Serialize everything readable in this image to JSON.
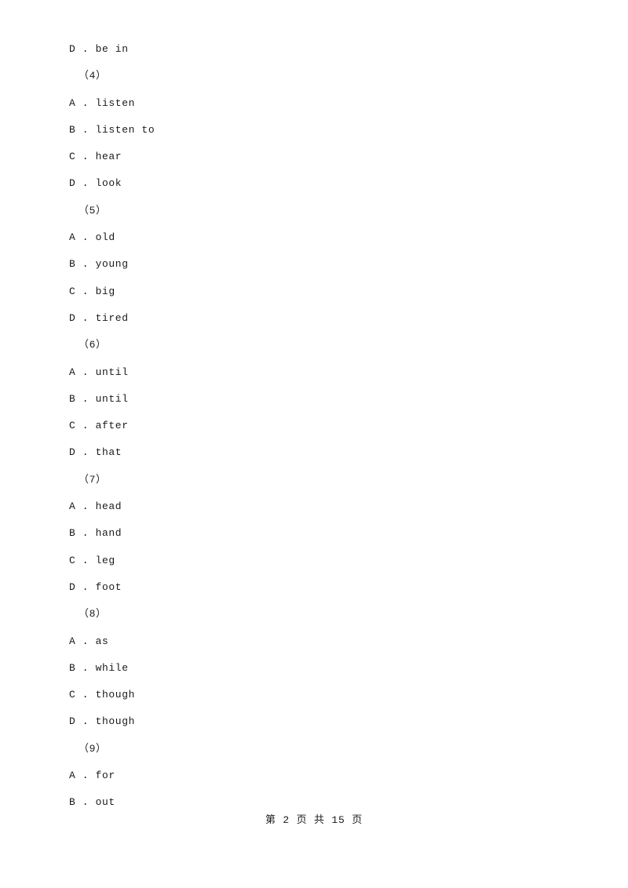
{
  "document": {
    "lines": [
      {
        "kind": "option",
        "text": "D . be in"
      },
      {
        "kind": "group",
        "text": "（4）"
      },
      {
        "kind": "option",
        "text": "A . listen"
      },
      {
        "kind": "option",
        "text": "B . listen to"
      },
      {
        "kind": "option",
        "text": "C . hear"
      },
      {
        "kind": "option",
        "text": "D . look"
      },
      {
        "kind": "group",
        "text": "（5）"
      },
      {
        "kind": "option",
        "text": "A . old"
      },
      {
        "kind": "option",
        "text": "B . young"
      },
      {
        "kind": "option",
        "text": "C . big"
      },
      {
        "kind": "option",
        "text": "D . tired"
      },
      {
        "kind": "group",
        "text": "（6）"
      },
      {
        "kind": "option",
        "text": "A . until"
      },
      {
        "kind": "option",
        "text": "B . until"
      },
      {
        "kind": "option",
        "text": "C . after"
      },
      {
        "kind": "option",
        "text": "D . that"
      },
      {
        "kind": "group",
        "text": "（7）"
      },
      {
        "kind": "option",
        "text": "A . head"
      },
      {
        "kind": "option",
        "text": "B . hand"
      },
      {
        "kind": "option",
        "text": "C . leg"
      },
      {
        "kind": "option",
        "text": "D . foot"
      },
      {
        "kind": "group",
        "text": "（8）"
      },
      {
        "kind": "option",
        "text": "A . as"
      },
      {
        "kind": "option",
        "text": "B . while"
      },
      {
        "kind": "option",
        "text": "C . though"
      },
      {
        "kind": "option",
        "text": "D . though"
      },
      {
        "kind": "group",
        "text": "（9）"
      },
      {
        "kind": "option",
        "text": "A . for"
      },
      {
        "kind": "option",
        "text": "B . out"
      }
    ],
    "footer": "第 2 页 共 15 页"
  }
}
